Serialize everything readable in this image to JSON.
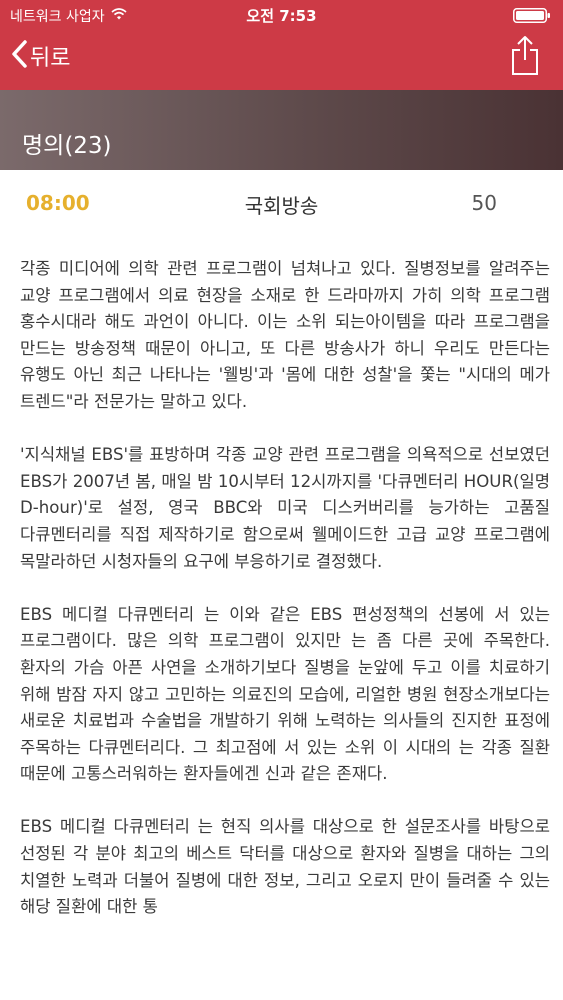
{
  "status_bar": {
    "carrier": "네트워크 사업자",
    "time": "오전 7:53"
  },
  "nav": {
    "back_label": "뒤로"
  },
  "section": {
    "title": "명의(23)"
  },
  "program": {
    "time": "08:00",
    "channel": "국회방송",
    "number": "50"
  },
  "colors": {
    "nav_background": "#cd3a46",
    "time_accent": "#e6b02d"
  },
  "article": {
    "paragraphs": [
      "각종 미디어에 의학 관련 프로그램이 넘쳐나고 있다. 질병정보를 알려주는 교양 프로그램에서 의료 현장을 소재로 한 드라마까지 가히 의학 프로그램 홍수시대라 해도 과언이 아니다. 이는 소위 되는아이템을 따라 프로그램을 만드는 방송정책 때문이 아니고, 또 다른 방송사가 하니 우리도 만든다는 유행도 아닌 최근 나타나는 '웰빙'과 '몸에 대한 성찰'을 쫓는 \"시대의 메가 트렌드\"라 전문가는 말하고 있다.",
      "'지식채널 EBS'를 표방하며 각종 교양 관련 프로그램을 의욕적으로 선보였던 EBS가 2007년 봄, 매일 밤 10시부터 12시까지를 '다큐멘터리 HOUR(일명 D-hour)'로 설정, 영국 BBC와 미국 디스커버리를 능가하는 고품질 다큐멘터리를 직접 제작하기로 함으로써 웰메이드한 고급 교양 프로그램에 목말라하던 시청자들의 요구에 부응하기로 결정했다.",
      "EBS 메디컬 다큐멘터리 는 이와 같은 EBS 편성정책의 선봉에 서 있는 프로그램이다. 많은 의학 프로그램이 있지만 는 좀 다른 곳에 주목한다. 환자의 가슴 아픈 사연을 소개하기보다 질병을 눈앞에 두고 이를 치료하기 위해 밤잠 자지 않고 고민하는 의료진의 모습에, 리얼한 병원 현장소개보다는 새로운 치료법과 수술법을 개발하기 위해 노력하는 의사들의 진지한 표정에 주목하는 다큐멘터리다. 그 최고점에 서 있는 소위 이 시대의 는 각종 질환 때문에 고통스러워하는 환자들에겐 신과 같은 존재다.",
      "EBS 메디컬 다큐멘터리 는 현직 의사를 대상으로 한 설문조사를 바탕으로 선정된 각 분야 최고의 베스트 닥터를 대상으로 환자와 질병을 대하는 그의 치열한 노력과 더불어 질병에 대한 정보, 그리고 오로지 만이 들려줄 수 있는 해당 질환에 대한 통"
    ]
  }
}
